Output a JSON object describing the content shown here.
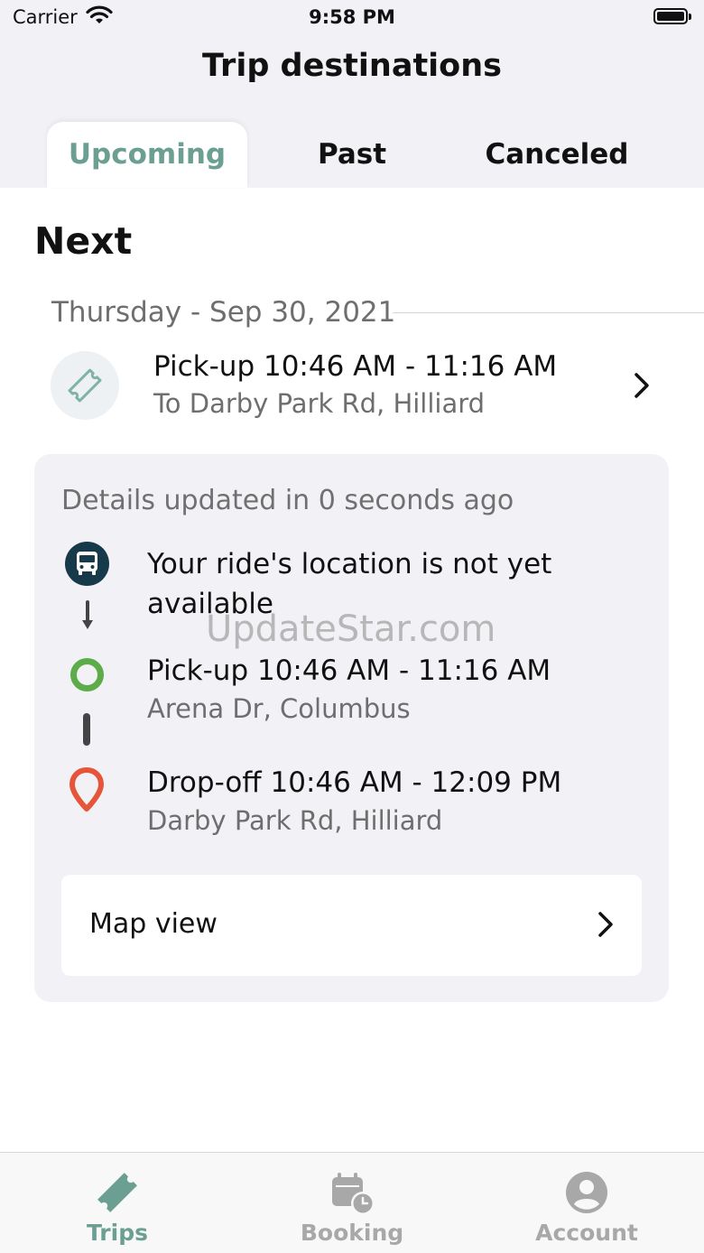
{
  "status_bar": {
    "carrier": "Carrier",
    "time": "9:58 PM"
  },
  "header": {
    "title": "Trip destinations"
  },
  "tabs": [
    {
      "label": "Upcoming",
      "active": true
    },
    {
      "label": "Past",
      "active": false
    },
    {
      "label": "Canceled",
      "active": false
    }
  ],
  "section": {
    "title": "Next"
  },
  "trip": {
    "date": "Thursday - Sep 30, 2021",
    "title": "Pick-up 10:46 AM - 11:16 AM",
    "subtitle": "To Darby Park Rd, Hilliard",
    "icon": "ticket-icon"
  },
  "details": {
    "updated": "Details updated in 0 seconds ago",
    "ride_status": "Your ride's location is not yet available",
    "pickup": {
      "title": "Pick-up 10:46 AM - 11:16 AM",
      "address": "Arena Dr, Columbus"
    },
    "dropoff": {
      "title": "Drop-off 10:46 AM - 12:09 PM",
      "address": "Darby Park Rd, Hilliard"
    },
    "map_view_label": "Map view"
  },
  "watermark": "UpdateStar.com",
  "tab_bar": {
    "items": [
      {
        "label": "Trips",
        "icon": "ticket-icon",
        "active": true
      },
      {
        "label": "Booking",
        "icon": "calendar-clock-icon",
        "active": false
      },
      {
        "label": "Account",
        "icon": "account-icon",
        "active": false
      }
    ]
  },
  "colors": {
    "accent": "#6b9f91",
    "header_bg": "#f2f2f6",
    "bus_icon_bg": "#173a4b",
    "pickup_green": "#5cac4a",
    "dropoff_red": "#e5553a",
    "secondary_text": "#6e6e6e"
  }
}
